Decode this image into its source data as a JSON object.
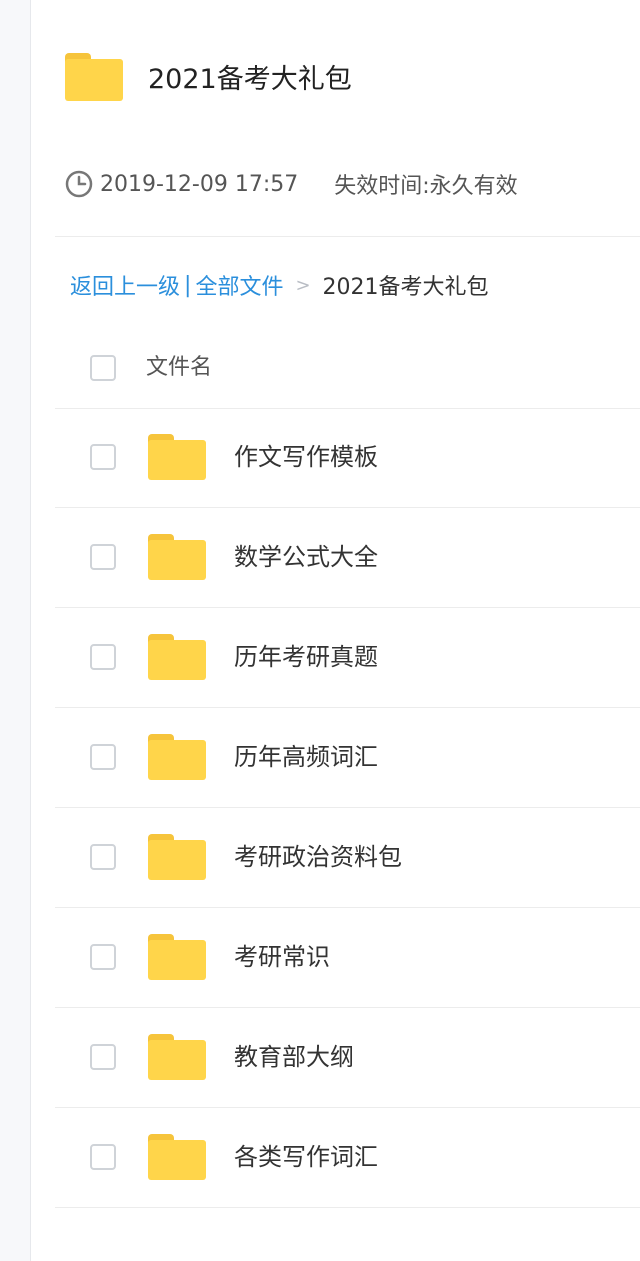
{
  "header": {
    "title": "2021备考大礼包",
    "date": "2019-12-09 17:57",
    "expire_label": "失效时间:",
    "expire_value": "永久有效"
  },
  "breadcrumb": {
    "back": "返回上一级",
    "divider": "|",
    "all_files": "全部文件",
    "separator": ">",
    "current": "2021备考大礼包"
  },
  "list": {
    "column_header": "文件名",
    "items": [
      {
        "name": "作文写作模板",
        "icon": "folder-icon"
      },
      {
        "name": "数学公式大全",
        "icon": "folder-icon"
      },
      {
        "name": "历年考研真题",
        "icon": "folder-icon"
      },
      {
        "name": "历年高频词汇",
        "icon": "folder-icon"
      },
      {
        "name": "考研政治资料包",
        "icon": "folder-icon"
      },
      {
        "name": "考研常识",
        "icon": "folder-icon"
      },
      {
        "name": "教育部大纲",
        "icon": "folder-icon"
      },
      {
        "name": "各类写作词汇",
        "icon": "folder-icon"
      }
    ]
  },
  "colors": {
    "folder": "#ffd54a",
    "folder_tab": "#f6c43b",
    "link": "#2b8fdc"
  }
}
